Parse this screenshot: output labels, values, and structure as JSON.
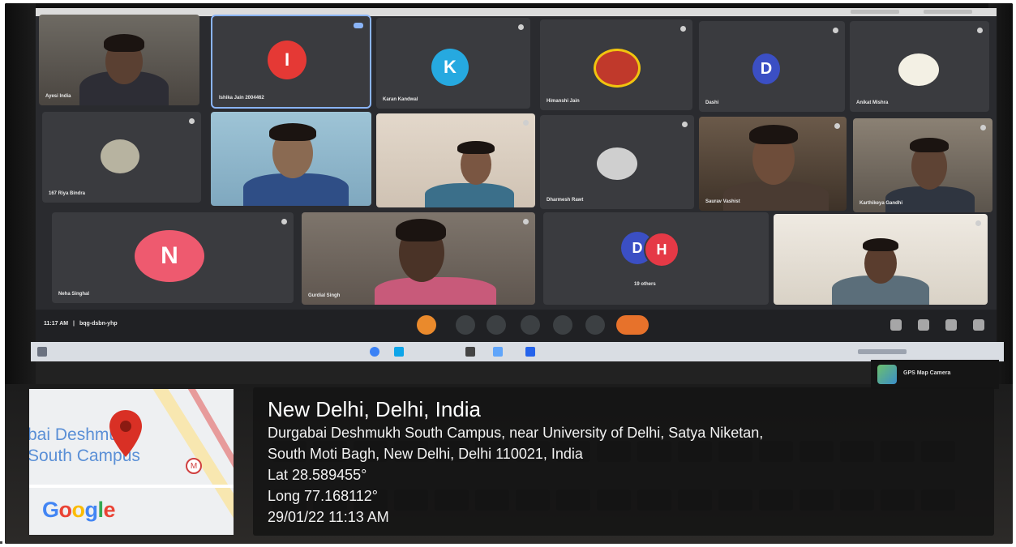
{
  "meeting": {
    "time": "11:17 AM",
    "separator": "|",
    "code": "bqg-dsbn-yhp",
    "participants": [
      {
        "name": "Ayesi India",
        "kind": "camera"
      },
      {
        "name": "Ishika Jain 2004462",
        "kind": "avatar",
        "initial": "I",
        "color": "#e53935",
        "active": true
      },
      {
        "name": "Karan Kandwal",
        "kind": "avatar",
        "initial": "K",
        "color": "#26a9e0"
      },
      {
        "name": "Himanshi Jain",
        "kind": "picture"
      },
      {
        "name": "Dashi",
        "kind": "avatar",
        "initial": "D",
        "color": "#3b4fc4"
      },
      {
        "name": "Anikat Mishra",
        "kind": "picture"
      },
      {
        "name": "167 Riya Bindra",
        "kind": "picture"
      },
      {
        "name": "",
        "kind": "camera"
      },
      {
        "name": "",
        "kind": "camera"
      },
      {
        "name": "Dharmesh Rawt",
        "kind": "picture"
      },
      {
        "name": "Saurav Vashist",
        "kind": "camera"
      },
      {
        "name": "Karthikeya Gandhi",
        "kind": "camera"
      },
      {
        "name": "Neha Singhal",
        "kind": "avatar",
        "initial": "N",
        "color": "#ee5a6f"
      },
      {
        "name": "Gurdial Singh",
        "kind": "camera"
      },
      {
        "name": "19 others",
        "kind": "others",
        "initials": [
          "D",
          "H"
        ],
        "colors": [
          "#3b4fc4",
          "#e53946"
        ]
      },
      {
        "name": "",
        "kind": "camera"
      }
    ]
  },
  "gps": {
    "app_label": "GPS Map Camera",
    "title": "New Delhi, Delhi, India",
    "address_line1": "Durgabai Deshmukh South Campus, near University of Delhi, Satya Niketan,",
    "address_line2": "South Moti Bagh, New Delhi, Delhi 110021, India",
    "lat": "Lat 28.589455°",
    "long": "Long 77.168112°",
    "datetime": "29/01/22 11:13 AM"
  },
  "map": {
    "label_line1": "bai Deshmukh",
    "label_line2": "South Campus",
    "brand": "Google",
    "brand_colors": [
      "#4285f4",
      "#ea4335",
      "#fbbc05",
      "#4285f4",
      "#34a853",
      "#ea4335"
    ]
  },
  "colors": {
    "accent_blue": "#8ab4f8",
    "end_call": "#e7722b"
  }
}
